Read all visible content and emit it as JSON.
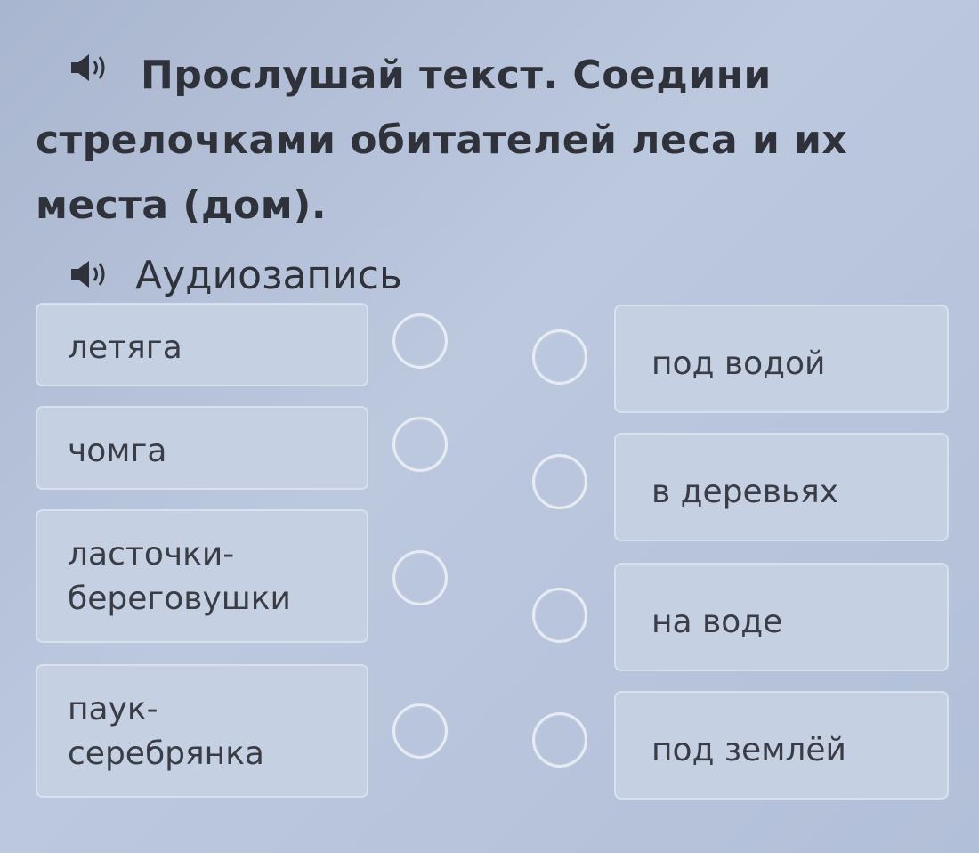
{
  "task": {
    "title": "Прослушай текст. Соедини стрелочками обитателей леса и их места (дом).",
    "audio_label": "Аудиозапись",
    "speaker_icon": "speaker-icon"
  },
  "left_items": [
    {
      "label": "летяга"
    },
    {
      "label": "чомга"
    },
    {
      "label": "ласточки-береговушки"
    },
    {
      "label": "паук-серебрянка"
    }
  ],
  "right_items": [
    {
      "label": "под водой"
    },
    {
      "label": "в деревьях"
    },
    {
      "label": "на воде"
    },
    {
      "label": "под землёй"
    }
  ]
}
